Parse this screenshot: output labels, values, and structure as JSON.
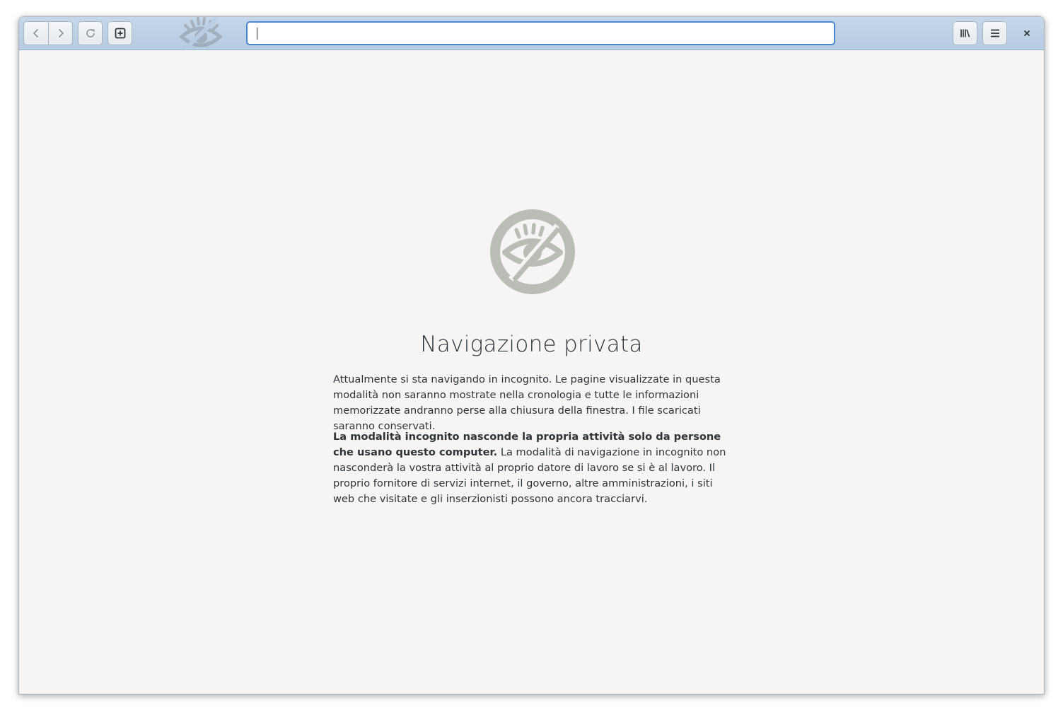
{
  "toolbar": {
    "back_icon": "chevron-left-icon",
    "forward_icon": "chevron-right-icon",
    "reload_icon": "reload-icon",
    "new_tab_icon": "new-tab-icon",
    "bookmarks_icon": "library-icon",
    "menu_icon": "hamburger-menu-icon",
    "close_label": "×"
  },
  "url_bar": {
    "value": "",
    "placeholder": ""
  },
  "page": {
    "icon": "incognito-eye-icon",
    "title": "Navigazione privata",
    "paragraph1": "Attualmente si sta navigando in incognito. Le pagine visualizzate in questa modalità non saranno mostrate nella cronologia e tutte le informazioni memorizzate andranno perse alla chiusura della finestra. I file scaricati saranno conservati.",
    "paragraph2_bold": "La modalità incognito nasconde la propria attività solo da persone che usano questo computer.",
    "paragraph2_rest": " La modalità di navigazione in incognito non nasconderà la vostra attività al proprio datore di lavoro se si è al lavoro. Il proprio fornitore di servizi internet, il governo, altre amministrazioni, i siti web che visitate e gli inserzionisti possono ancora tracciarvi."
  },
  "colors": {
    "headerbar": "#b9cee4",
    "urlbar_focus": "#4a86cf",
    "background": "#f6f5f4",
    "icon": "#babdb6",
    "text": "#2e3436"
  }
}
